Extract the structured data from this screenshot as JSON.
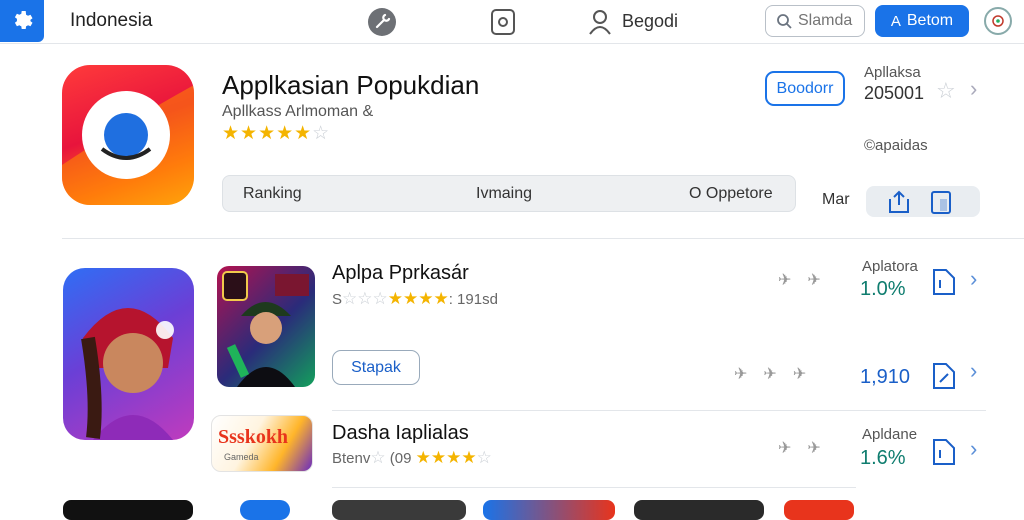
{
  "header": {
    "country": "Indonesia",
    "tab_label": "Begodi",
    "search_placeholder": "Slamda",
    "primary_button": "Betom"
  },
  "featured": {
    "title": "Applkasian Popukdian",
    "subtitle": "Apllkass Arlmoman &",
    "rating_stars": 5,
    "seg_tabs": [
      "Ranking",
      "Ivmaing",
      "O Oppetore"
    ],
    "action_button": "Boodorr",
    "side_label": "Apllaksa",
    "side_count": "205001",
    "side_note": "©apaidas",
    "share_label": "Mar"
  },
  "list": [
    {
      "title": "Aplpa Pprkasár",
      "meta_prefix": "S",
      "meta_suffix": ": 191sd",
      "side_label": "Aplatora",
      "percent": "1.0%"
    },
    {
      "button": "Stapak",
      "count": "1,910"
    },
    {
      "title": "Dasha Iaplialas",
      "meta_prefix": "Btenv",
      "meta_mid": "(09",
      "side_label": "Apldane",
      "percent": "1.6%",
      "thumb_text": "Ssskokh",
      "thumb_subtext": "Gameda"
    }
  ],
  "colors": {
    "accent": "#1a73e8",
    "star": "#f4b400",
    "percent": "#0f7d6f"
  }
}
